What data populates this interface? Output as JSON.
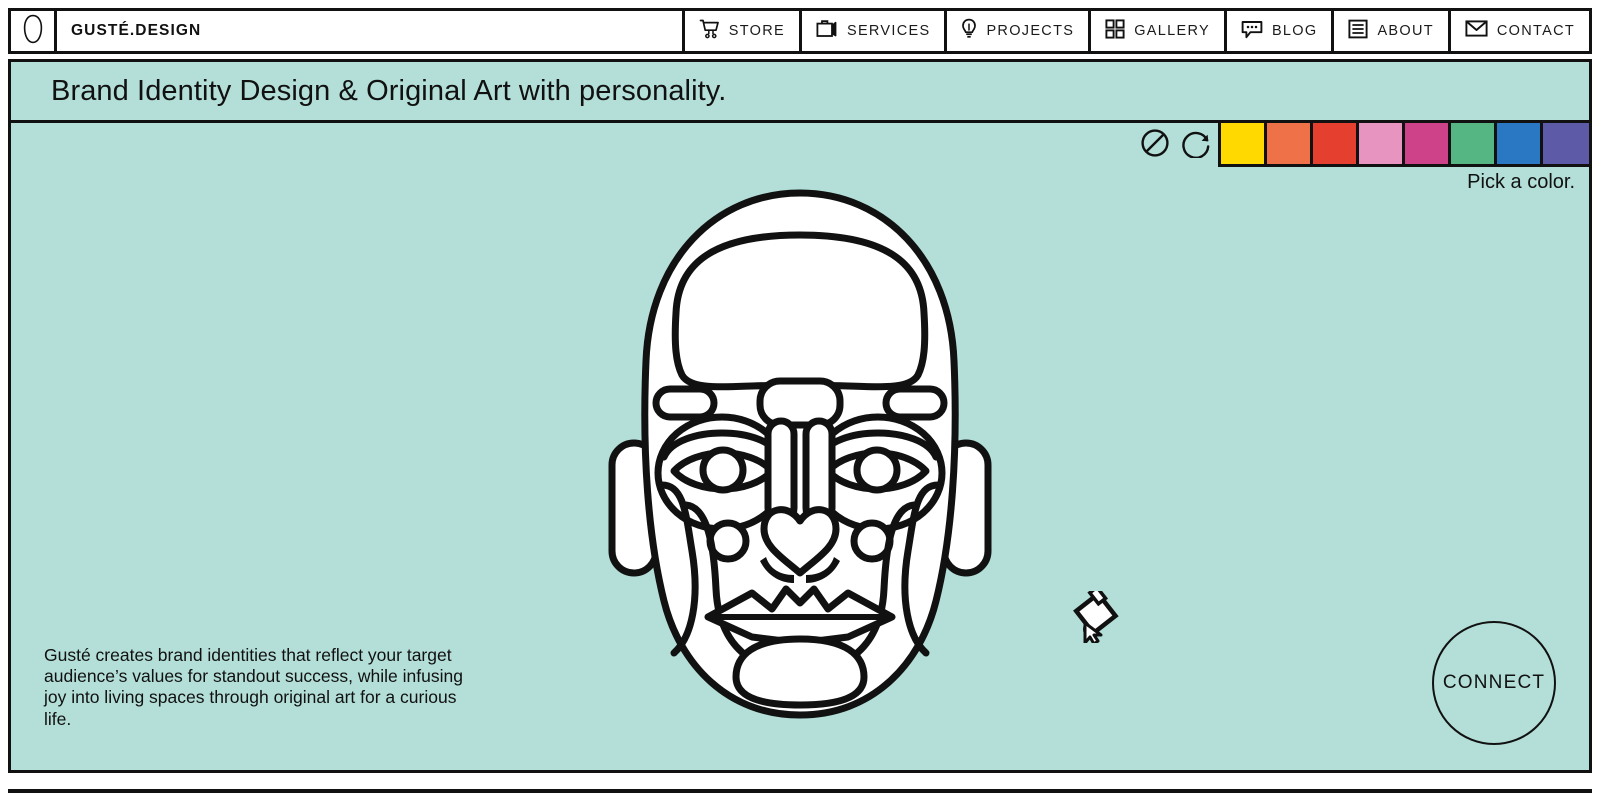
{
  "header": {
    "logo_icon": "head-outline-logo-icon",
    "brand": "GUSTÉ.DESIGN",
    "nav": [
      {
        "label": "STORE",
        "icon": "shopping-cart-icon"
      },
      {
        "label": "SERVICES",
        "icon": "briefcase-icon"
      },
      {
        "label": "PROJECTS",
        "icon": "lightbulb-icon"
      },
      {
        "label": "GALLERY",
        "icon": "grid-icon"
      },
      {
        "label": "BLOG",
        "icon": "speech-bubble-icon"
      },
      {
        "label": "ABOUT",
        "icon": "list-lines-icon"
      },
      {
        "label": "CONTACT",
        "icon": "envelope-icon"
      }
    ]
  },
  "hero": {
    "headline": "Brand Identity Design & Original Art with personality.",
    "background_color": "#b3dfd8",
    "blurb": "Gusté creates brand identities that reflect your target audience’s values for standout success, while infusing joy into living spaces through original art for a curious life.",
    "connect_label": "CONNECT"
  },
  "color_tool": {
    "pick_label": "Pick a color.",
    "no_color_icon": "no-color-circle-slash-icon",
    "reset_icon": "reset-circular-arrow-icon",
    "swatches": [
      {
        "name": "yellow",
        "hex": "#ffd900"
      },
      {
        "name": "orange",
        "hex": "#ee7148"
      },
      {
        "name": "red",
        "hex": "#e5402f"
      },
      {
        "name": "pink",
        "hex": "#e794c0"
      },
      {
        "name": "magenta",
        "hex": "#ce4289"
      },
      {
        "name": "green",
        "hex": "#55b583"
      },
      {
        "name": "blue",
        "hex": "#2a78c4"
      },
      {
        "name": "purple",
        "hex": "#5d5ba8"
      }
    ]
  },
  "artwork": {
    "name": "line-art-face-illustration",
    "stroke_color": "#111111",
    "fill_color": "#ffffff"
  },
  "cursor": {
    "icon": "paint-bucket-fill-cursor-icon"
  }
}
